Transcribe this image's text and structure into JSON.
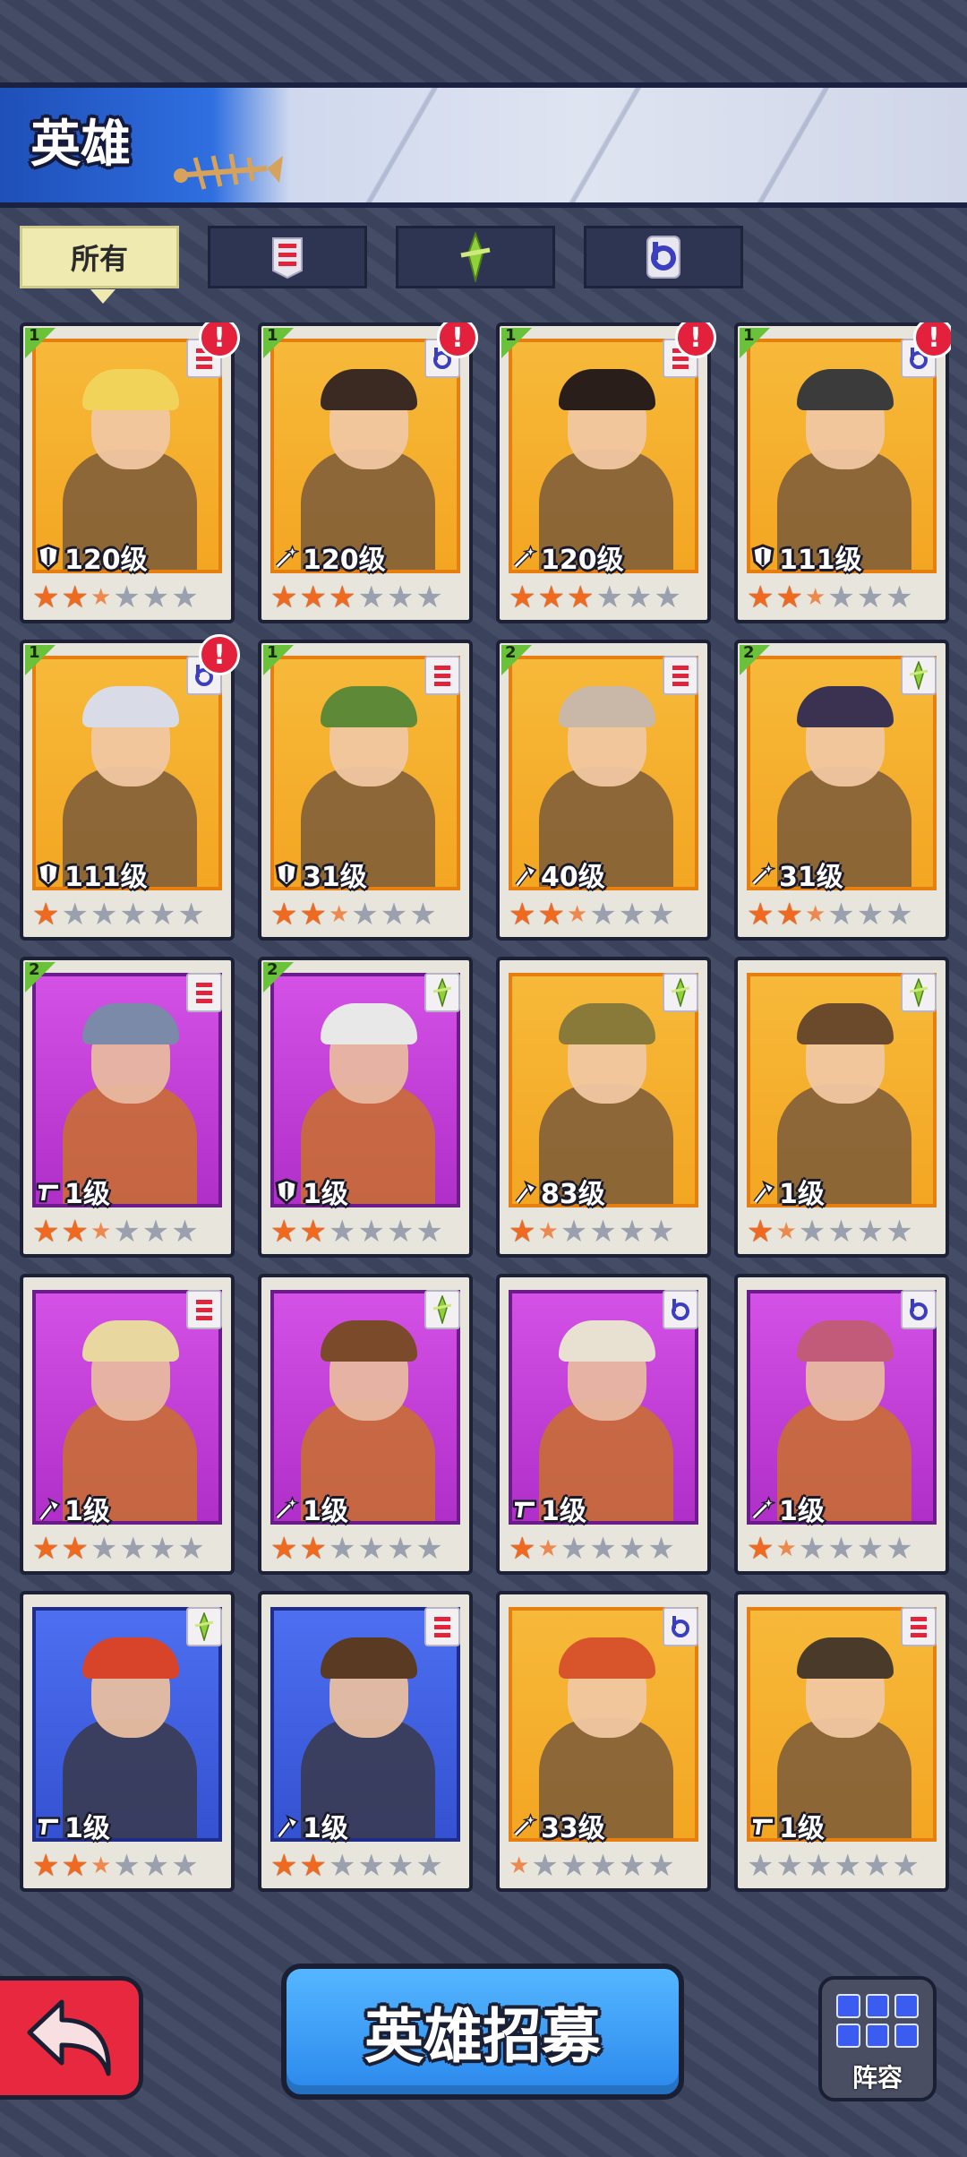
{
  "header": {
    "title": "英雄"
  },
  "tabs": [
    {
      "label": "所有",
      "icon": "all",
      "active": true
    },
    {
      "label": "",
      "icon": "faction-e-icon",
      "active": false
    },
    {
      "label": "",
      "icon": "faction-sword-icon",
      "active": false
    },
    {
      "label": "",
      "icon": "faction-bq-icon",
      "active": false
    }
  ],
  "heroes": [
    {
      "rank": "1",
      "faction": "E",
      "level": "120级",
      "class_icon": "shield",
      "stars": 2.5,
      "alert": true,
      "bg": "orange"
    },
    {
      "rank": "1",
      "faction": "Q",
      "level": "120级",
      "class_icon": "magic",
      "stars": 3,
      "alert": true,
      "bg": "orange"
    },
    {
      "rank": "1",
      "faction": "E",
      "level": "120级",
      "class_icon": "magic",
      "stars": 3,
      "alert": true,
      "bg": "orange"
    },
    {
      "rank": "1",
      "faction": "Q",
      "level": "111级",
      "class_icon": "shield",
      "stars": 2.5,
      "alert": true,
      "bg": "orange"
    },
    {
      "rank": "1",
      "faction": "Q",
      "level": "111级",
      "class_icon": "shield",
      "stars": 1,
      "alert": true,
      "bg": "orange"
    },
    {
      "rank": "1",
      "faction": "E",
      "level": "31级",
      "class_icon": "shield",
      "stars": 2.5,
      "alert": false,
      "bg": "orange"
    },
    {
      "rank": "2",
      "faction": "E",
      "level": "40级",
      "class_icon": "axe",
      "stars": 2.5,
      "alert": false,
      "bg": "orange"
    },
    {
      "rank": "2",
      "faction": "S",
      "level": "31级",
      "class_icon": "magic",
      "stars": 2.5,
      "alert": false,
      "bg": "orange"
    },
    {
      "rank": "2",
      "faction": "E",
      "level": "1级",
      "class_icon": "gun",
      "stars": 2.5,
      "alert": false,
      "bg": "purple"
    },
    {
      "rank": "2",
      "faction": "S",
      "level": "1级",
      "class_icon": "shield",
      "stars": 2,
      "alert": false,
      "bg": "purple"
    },
    {
      "rank": "",
      "faction": "S",
      "level": "83级",
      "class_icon": "axe",
      "stars": 1.5,
      "alert": false,
      "bg": "orange"
    },
    {
      "rank": "",
      "faction": "S",
      "level": "1级",
      "class_icon": "axe",
      "stars": 1.5,
      "alert": false,
      "bg": "orange"
    },
    {
      "rank": "",
      "faction": "E",
      "level": "1级",
      "class_icon": "axe",
      "stars": 2,
      "alert": false,
      "bg": "purple"
    },
    {
      "rank": "",
      "faction": "S",
      "level": "1级",
      "class_icon": "magic",
      "stars": 2,
      "alert": false,
      "bg": "purple"
    },
    {
      "rank": "",
      "faction": "Q",
      "level": "1级",
      "class_icon": "gun",
      "stars": 1.5,
      "alert": false,
      "bg": "purple"
    },
    {
      "rank": "",
      "faction": "Q",
      "level": "1级",
      "class_icon": "magic",
      "stars": 1.5,
      "alert": false,
      "bg": "purple"
    },
    {
      "rank": "",
      "faction": "S",
      "level": "1级",
      "class_icon": "gun",
      "stars": 2.5,
      "alert": false,
      "bg": "blue"
    },
    {
      "rank": "",
      "faction": "E",
      "level": "1级",
      "class_icon": "axe",
      "stars": 2,
      "alert": false,
      "bg": "blue"
    },
    {
      "rank": "",
      "faction": "Q",
      "level": "33级",
      "class_icon": "magic",
      "stars": 0.5,
      "alert": false,
      "bg": "orange"
    },
    {
      "rank": "",
      "faction": "E",
      "level": "1级",
      "class_icon": "gun",
      "stars": 0,
      "alert": false,
      "bg": "orange"
    }
  ],
  "bottom": {
    "recruit_label": "英雄招募",
    "lineup_label": "阵容"
  },
  "colors": {
    "card_orange": "#f3a622",
    "card_purple": "#b02fc9",
    "card_blue": "#3452d2",
    "star_on": "#ef6a1f",
    "alert": "#e3213c",
    "recruit": "#2b88ec",
    "back": "#e8283e"
  }
}
